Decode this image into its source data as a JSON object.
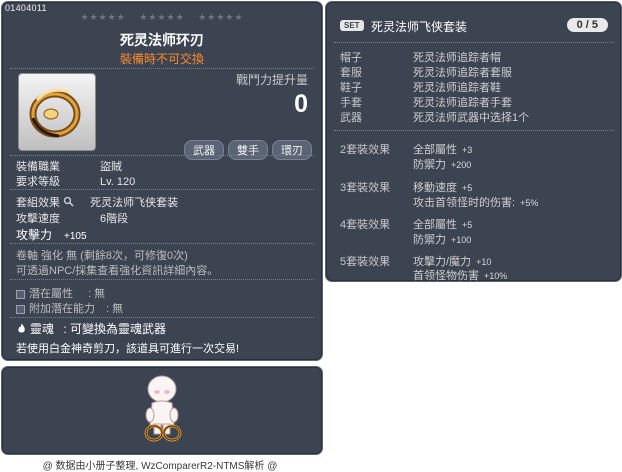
{
  "item": {
    "code": "01404011",
    "stars": [
      "★★★★★",
      "★★★★★",
      "★★★★★"
    ],
    "name": "死灵法师环刃",
    "trade_note": "裝備時不可交換",
    "combat_power_label": "戰鬥力提升量",
    "combat_power_value": "0",
    "tags": [
      "武器",
      "雙手",
      "環刃"
    ],
    "job_label": "裝備職業",
    "job_value": "盜賊",
    "req_level_label": "要求等級",
    "req_level_value": "Lv. 120",
    "set_label": "套組效果",
    "set_value": "死灵法师飞侠套装",
    "attack_speed_label": "攻擊速度",
    "attack_speed_value": "6階段",
    "attack_label": "攻擊力",
    "attack_value": "+105",
    "scroll_text": "卷軸 強化 無 (剩餘8次，可修復0次)",
    "npc_text": "可透過NPC/採集查看強化資訊詳細內容。",
    "potential_label": "潛在屬性",
    "potential_value": ": 無",
    "add_potential_label": "附加潛在能力",
    "add_potential_value": ": 無",
    "soul_label": "靈魂",
    "soul_value": ": 可變換為靈魂武器",
    "scissors_note": "若使用白金神奇剪刀，該道具可進行一次交易!"
  },
  "set": {
    "badge": "SET",
    "title": "死灵法师飞侠套装",
    "count": "0 / 5",
    "pieces": [
      {
        "slot": "帽子",
        "name": "死灵法师追踪者帽"
      },
      {
        "slot": "套服",
        "name": "死灵法师追踪者套服"
      },
      {
        "slot": "鞋子",
        "name": "死灵法师追踪者鞋"
      },
      {
        "slot": "手套",
        "name": "死灵法师追踪者手套"
      },
      {
        "slot": "武器",
        "name": "死灵法师武器中选择1个"
      }
    ],
    "effects": [
      {
        "tier": "2套裝效果",
        "lines": [
          {
            "stat": "全部屬性",
            "value": "+3"
          },
          {
            "stat": "防禦力",
            "value": "+200"
          }
        ]
      },
      {
        "tier": "3套裝效果",
        "lines": [
          {
            "stat": "移動速度",
            "value": "+5"
          },
          {
            "stat": "攻击首领怪时的伤害:",
            "value": "+5%"
          }
        ]
      },
      {
        "tier": "4套裝效果",
        "lines": [
          {
            "stat": "全部屬性",
            "value": "+5"
          },
          {
            "stat": "防禦力",
            "value": "+100"
          }
        ]
      },
      {
        "tier": "5套裝效果",
        "lines": [
          {
            "stat": "攻擊力/魔力",
            "value": "+10"
          },
          {
            "stat": "首领怪物伤害",
            "value": "+10%"
          }
        ]
      }
    ]
  },
  "footer": "@ 数据由小册子整理, WzComparerR2-NTMS解析 @",
  "colors": {
    "panel_bg": "#3c4452",
    "panel_border": "#5d6677",
    "trade_note": "#ff8a2a"
  }
}
